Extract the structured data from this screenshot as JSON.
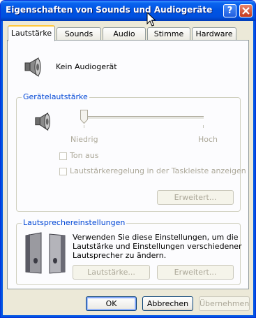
{
  "window": {
    "title": "Eigenschaften von Sounds und Audiogeräte",
    "help_label": "?",
    "close_label": "×"
  },
  "tabs": [
    {
      "label": "Lautstärke",
      "active": true
    },
    {
      "label": "Sounds",
      "active": false
    },
    {
      "label": "Audio",
      "active": false
    },
    {
      "label": "Stimme",
      "active": false
    },
    {
      "label": "Hardware",
      "active": false
    }
  ],
  "device": {
    "name": "Kein Audiogerät",
    "icon": "speaker-icon"
  },
  "device_volume": {
    "group_label": "Gerätelautstärke",
    "slider_min_label": "Niedrig",
    "slider_max_label": "Hoch",
    "slider_value": 0,
    "mute_label": "Ton aus",
    "taskbar_label": "Lautstärkeregelung in der Taskleiste anzeigen",
    "advanced_label": "Erweitert..."
  },
  "speaker_settings": {
    "group_label": "Lautsprechereinstellungen",
    "description": [
      "Verwenden Sie diese Einstellungen, um die",
      "Lautstärke und Einstellungen verschiedener",
      "Lautsprecher zu ändern."
    ],
    "volume_button": "Lautstärke...",
    "advanced_button": "Erweitert..."
  },
  "footer": {
    "ok": "OK",
    "cancel": "Abbrechen",
    "apply": "Übernehmen"
  },
  "colors": {
    "titlebar": "#0054e3",
    "group_label": "#0046d5",
    "disabled_text": "#aca899",
    "tab_highlight": "#ffc83c"
  }
}
